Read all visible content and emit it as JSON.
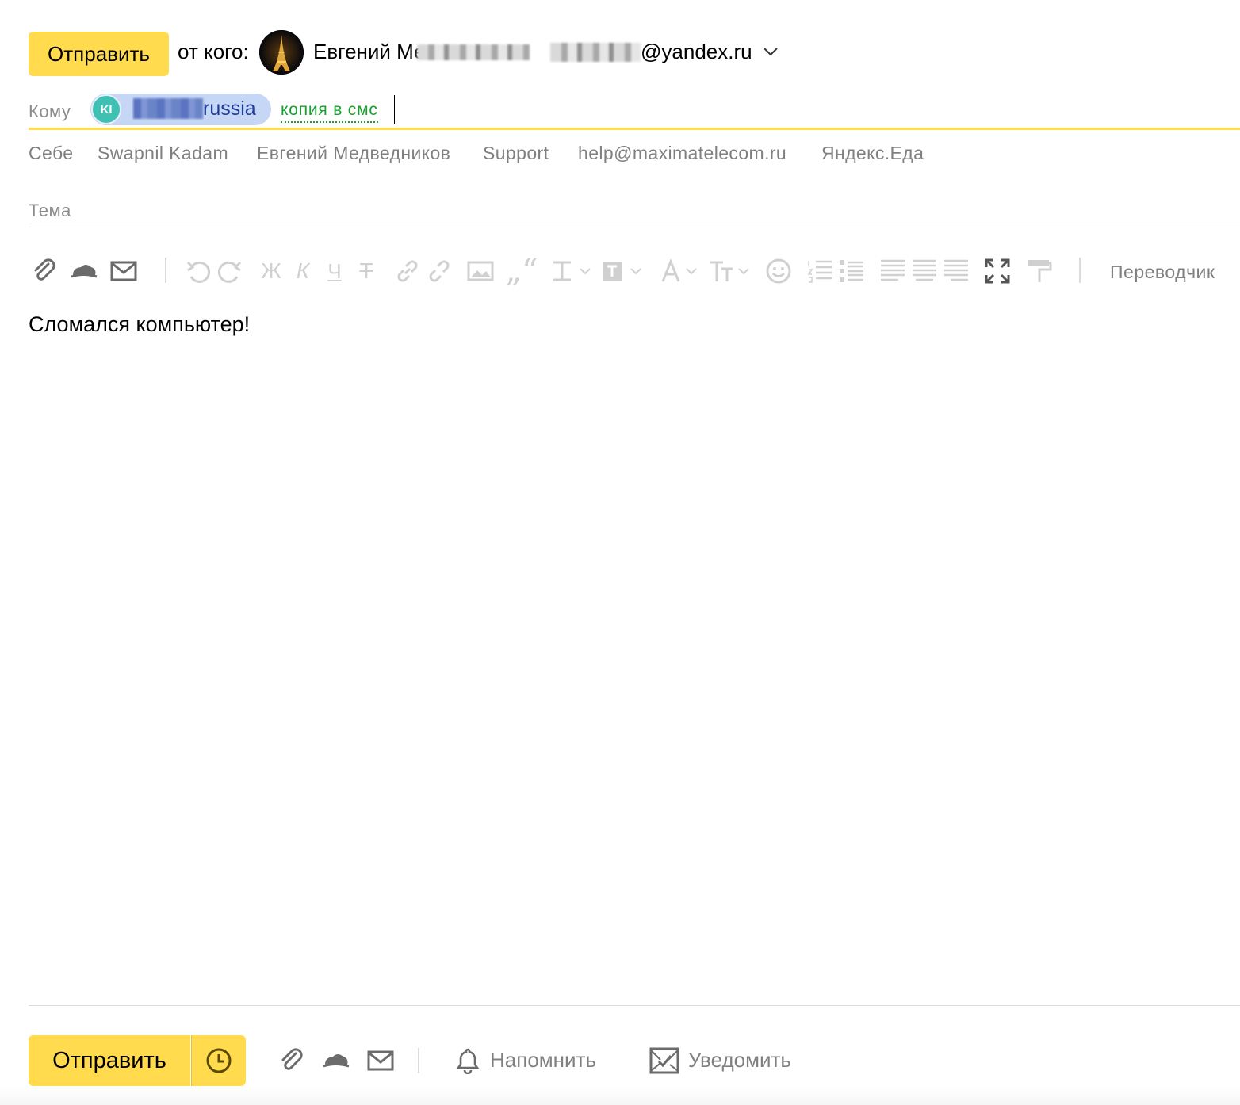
{
  "header": {
    "send_label": "Отправить",
    "from_label": "от кого:",
    "from_name": "Евгений Ме",
    "from_email_domain": "@yandex.ru"
  },
  "to": {
    "label": "Кому",
    "recipient_initials": "KI",
    "recipient_visible_text": "russia",
    "sms_copy_label": "копия в смс"
  },
  "suggestions": [
    "Себе",
    "Swapnil Kadam",
    "Евгений Медведников",
    "Support",
    "help@maximatelecom.ru",
    "Яндекс.Еда"
  ],
  "subject": {
    "label": "Тема"
  },
  "toolbar": {
    "icons": [
      "attach-icon",
      "disk-icon",
      "mail-attach-icon",
      "undo-icon",
      "redo-icon",
      "bold-icon",
      "italic-icon",
      "underline-icon",
      "strikethrough-icon",
      "link-icon",
      "unlink-icon",
      "image-icon",
      "quote-icon",
      "text-style-icon",
      "text-bg-icon",
      "font-color-icon",
      "font-size-icon",
      "emoji-icon",
      "numbered-list-icon",
      "bullet-list-icon",
      "align-left-icon",
      "align-center-icon",
      "align-right-icon",
      "fullscreen-icon",
      "format-painter-icon"
    ],
    "translator_label": "Переводчик"
  },
  "body": {
    "text": "Сломался компьютер!"
  },
  "footer": {
    "send_label": "Отправить",
    "remind_label": "Напомнить",
    "notify_label": "Уведомить"
  },
  "colors": {
    "accent": "#ffdb4d",
    "sms_green": "#18a02c",
    "chip_bg": "#c6d6f5",
    "avatar_teal": "#3ec1b3",
    "muted_text": "#808080"
  }
}
